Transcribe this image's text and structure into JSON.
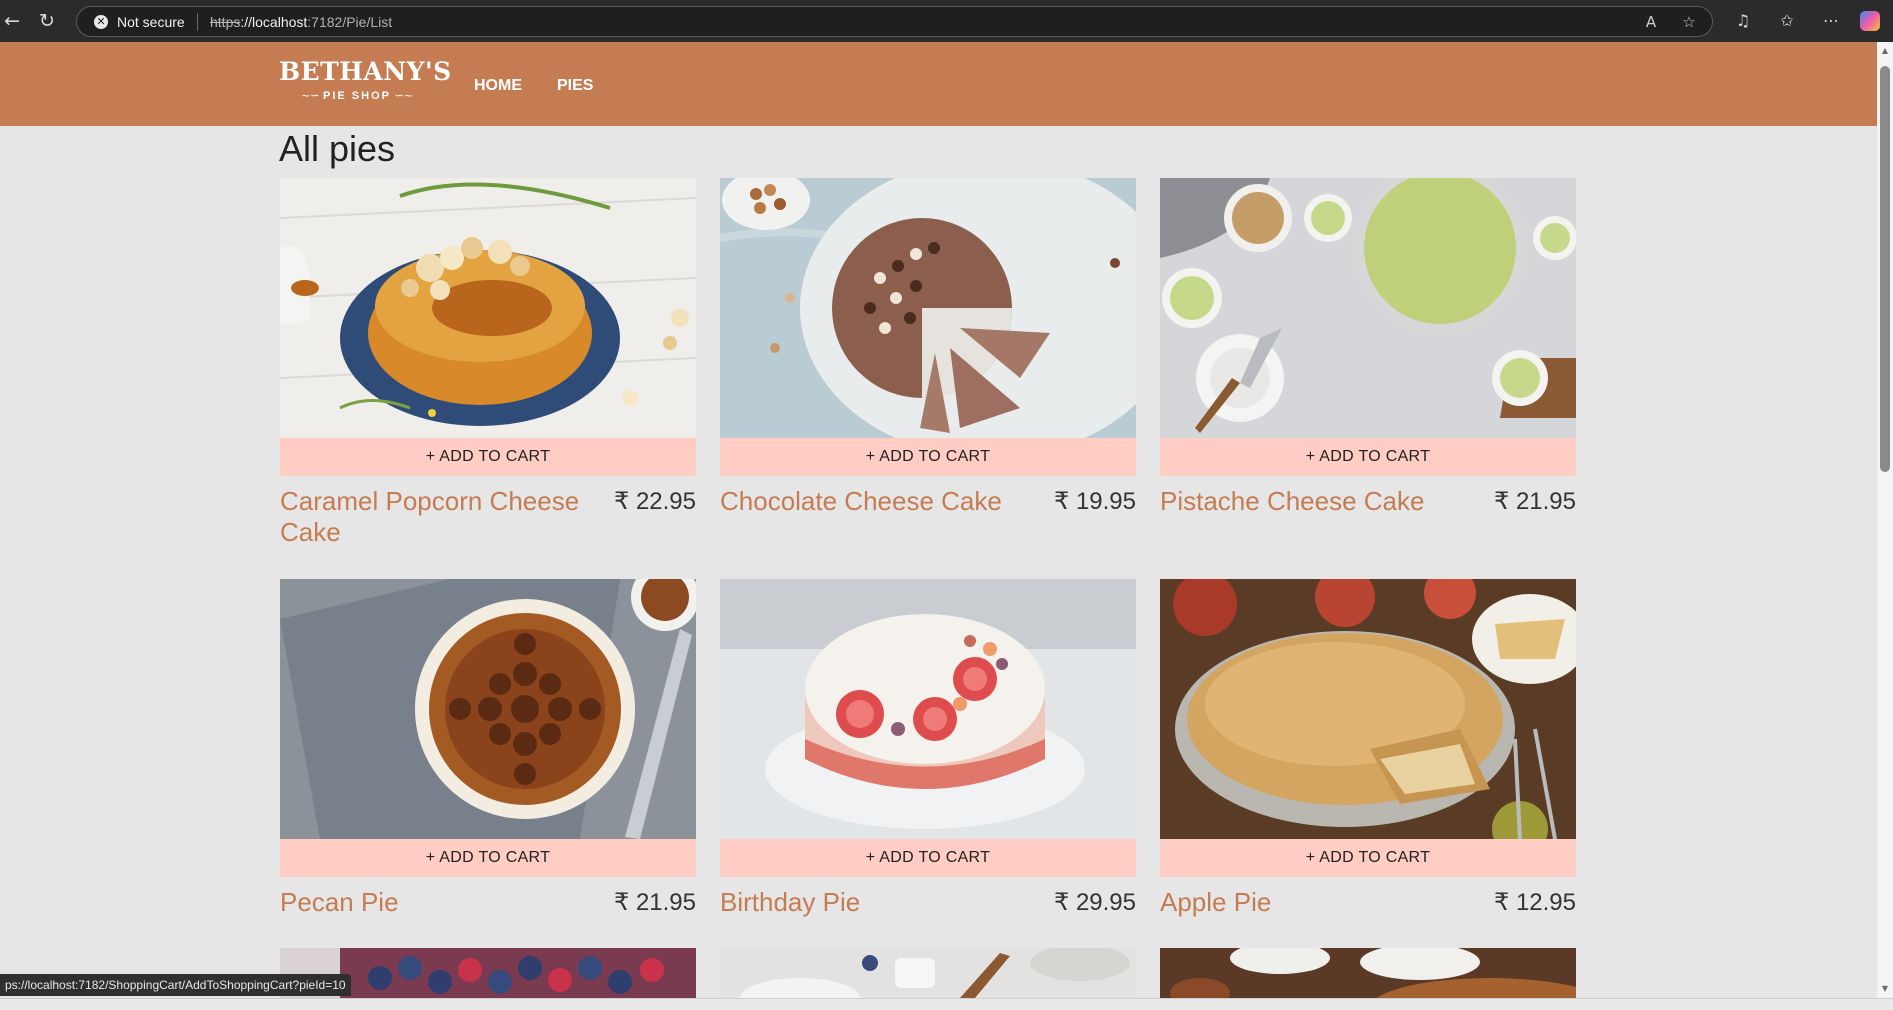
{
  "browser": {
    "security_label": "Not secure",
    "url_scheme": "https",
    "url_host": "://localhost",
    "url_path": ":7182/Pie/List"
  },
  "site": {
    "logo_title": "BETHANY'S",
    "logo_subtitle": "PIE SHOP",
    "nav": [
      {
        "label": "HOME"
      },
      {
        "label": "PIES"
      }
    ]
  },
  "page": {
    "title": "All pies",
    "currency_symbol": "₹",
    "pies": [
      {
        "name": "Caramel Popcorn Cheese Cake",
        "price": "₹ 22.95",
        "add_label": "+ ADD TO CART"
      },
      {
        "name": "Chocolate Cheese Cake",
        "price": "₹ 19.95",
        "add_label": "+ ADD TO CART"
      },
      {
        "name": "Pistache Cheese Cake",
        "price": "₹ 21.95",
        "add_label": "+ ADD TO CART"
      },
      {
        "name": "Pecan Pie",
        "price": "₹ 21.95",
        "add_label": "+ ADD TO CART"
      },
      {
        "name": "Birthday Pie",
        "price": "₹ 29.95",
        "add_label": "+ ADD TO CART"
      },
      {
        "name": "Apple Pie",
        "price": "₹ 12.95",
        "add_label": "+ ADD TO CART"
      }
    ]
  },
  "status_bar": {
    "link_url": "ps://localhost:7182/ShoppingCart/AddToShoppingCart?pieId=10"
  },
  "colors": {
    "header": "#c67c52",
    "cart_button": "#ffcdc4",
    "pie_name": "#c67c52",
    "page_background": "#e6e6e6"
  }
}
